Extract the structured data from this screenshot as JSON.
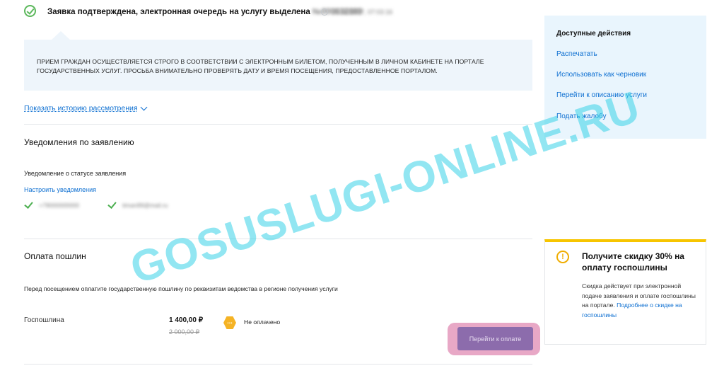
{
  "header": {
    "title": "Заявка подтверждена, электронная очередь на услугу выделена",
    "application_number": "№000032889",
    "timestamp": "25.05.2017, 07:03:16"
  },
  "info_box": {
    "text": "ПРИЕМ ГРАЖДАН ОСУЩЕСТВЛЯЕТСЯ СТРОГО В СООТВЕТСТВИИ С ЭЛЕКТРОННЫМ БИЛЕТОМ, ПОЛУЧЕННЫМ В ЛИЧНОМ КАБИНЕТЕ НА ПОРТАЛЕ ГОСУДАРСТВЕННЫХ УСЛУГ. ПРОСЬБА ВНИМАТЕЛЬНО ПРОВЕРЯТЬ ДАТУ И ВРЕМЯ ПОСЕЩЕНИЯ, ПРЕДОСТАВЛЕННОЕ ПОРТАЛОМ."
  },
  "history_link": "Показать историю рассмотрения",
  "notifications": {
    "title": "Уведомления по заявлению",
    "subtitle": "Уведомление о статусе заявления",
    "configure_link": "Настроить уведомления",
    "phone": "+79000000000",
    "email": "timan99@mail.ru"
  },
  "payment": {
    "title": "Оплата пошлин",
    "description": "Перед посещением оплатите государственную пошлину по реквизитам ведомства в регионе получения услуги",
    "fee_label": "Госпошлина",
    "price": "1 400,00 ₽",
    "old_price": "2 000,00 ₽",
    "status": "Не оплачено",
    "status_icon": "...",
    "pay_button": "Перейти к оплате"
  },
  "sidebar": {
    "title": "Доступные действия",
    "actions": [
      "Распечатать",
      "Использовать как черновик",
      "Перейти к описанию услуги",
      "Подать жалобу"
    ]
  },
  "promo": {
    "icon": "!",
    "title": "Получите скидку 30% на оплату госпошлины",
    "text": "Скидка действует при электронной подаче заявления и оплате госпошлины на портале.",
    "link": "Подробнее о скидке на госпошлины"
  },
  "watermark": "GOSUSLUGI-ONLINE.RU",
  "colors": {
    "link": "#0d6fd1",
    "success": "#5cb85c",
    "warning": "#f7c500",
    "pay_button": "#8c6cac"
  }
}
